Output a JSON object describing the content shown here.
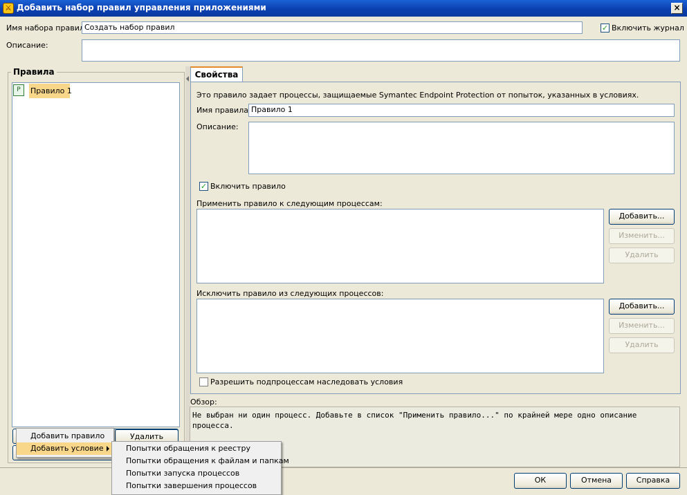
{
  "window": {
    "title": "Добавить набор правил управления приложениями",
    "close_glyph": "×"
  },
  "header": {
    "ruleset_name_label": "Имя набора правил:",
    "ruleset_name_value": "Создать набор правил",
    "enable_log_label": "Включить журнал",
    "enable_log_checked": true,
    "description_label": "Описание:",
    "description_value": ""
  },
  "rules_panel": {
    "title": "Правила",
    "rules": [
      {
        "label": "Правило 1",
        "icon": "rule-document-icon"
      }
    ],
    "add_rule_label": "Добавить правило",
    "delete_label": "Удалить",
    "add_condition_label": "Добавить условие"
  },
  "properties": {
    "tab_label": "Свойства",
    "intro_text": "Это правило задает процессы, защищаемые Symantec Endpoint Protection от попыток, указанных в условиях.",
    "rule_name_label": "Имя правила:",
    "rule_name_value": "Правило 1",
    "description_label": "Описание:",
    "enable_rule_label": "Включить правило",
    "enable_rule_checked": true,
    "apply_label": "Применить правило к следующим процессам:",
    "exclude_label": "Исключить правило из следующих процессов:",
    "add_label": "Добавить...",
    "edit_label": "Изменить...",
    "delete_label": "Удалить",
    "inherit_label": "Разрешить подпроцессам наследовать условия",
    "inherit_checked": false
  },
  "overview": {
    "label": "Обзор:",
    "text": "Не выбран ни один процесс.  Добавьте в список \"Применить правило...\" по крайней мере одно описание процесса."
  },
  "submenu": {
    "items": [
      "Попытки обращения к реестру",
      "Попытки обращения к файлам и папкам",
      "Попытки запуска процессов",
      "Попытки завершения процессов"
    ]
  },
  "footer": {
    "ok_label": "ОК",
    "cancel_label": "Отмена",
    "help_label": "Справка"
  },
  "colors": {
    "title_bar": "#0a3fb0",
    "highlight": "#f8d78a",
    "window_bg": "#ece9d8"
  }
}
